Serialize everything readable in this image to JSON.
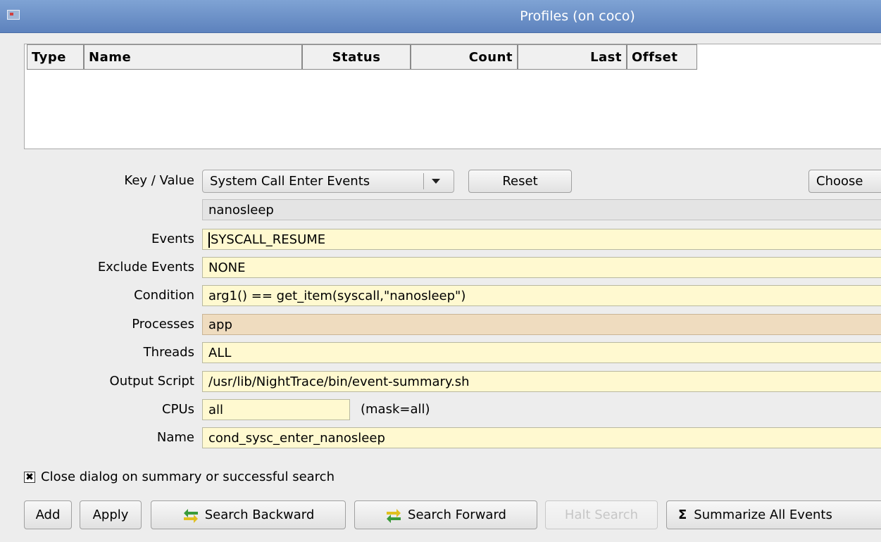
{
  "window": {
    "title": "Profiles (on coco)"
  },
  "table": {
    "columns": [
      "Type",
      "Name",
      "Status",
      "Count",
      "Last",
      "Offset"
    ]
  },
  "form": {
    "key_value_label": "Key / Value",
    "key_value_selected": "System Call Enter Events",
    "reset_label": "Reset",
    "choose_label": "Choose",
    "value_field": "nanosleep",
    "events_label": "Events",
    "events_value": "SYSCALL_RESUME",
    "exclude_label": "Exclude Events",
    "exclude_value": "NONE",
    "condition_label": "Condition",
    "condition_value": "arg1() == get_item(syscall,\"nanosleep\")",
    "processes_label": "Processes",
    "processes_value": "app",
    "threads_label": "Threads",
    "threads_value": "ALL",
    "output_label": "Output Script",
    "output_value": "/usr/lib/NightTrace/bin/event-summary.sh",
    "cpus_label": "CPUs",
    "cpus_value": "all",
    "cpus_mask": "(mask=all)",
    "name_label": "Name",
    "name_value": "cond_sysc_enter_nanosleep"
  },
  "options": {
    "close_dialog_label": "Close dialog on summary or successful search",
    "close_dialog_checked": true
  },
  "buttons": {
    "add": "Add",
    "apply": "Apply",
    "search_backward": "Search Backward",
    "search_forward": "Search Forward",
    "halt_search": "Halt Search",
    "summarize": "Summarize All Events"
  },
  "colors": {
    "titlebar": "#6b8fc9",
    "input_bg": "#fff9d0",
    "processes_bg": "#efdcbf",
    "icon_green": "#3a9a3a",
    "icon_yellow": "#e0c020"
  }
}
